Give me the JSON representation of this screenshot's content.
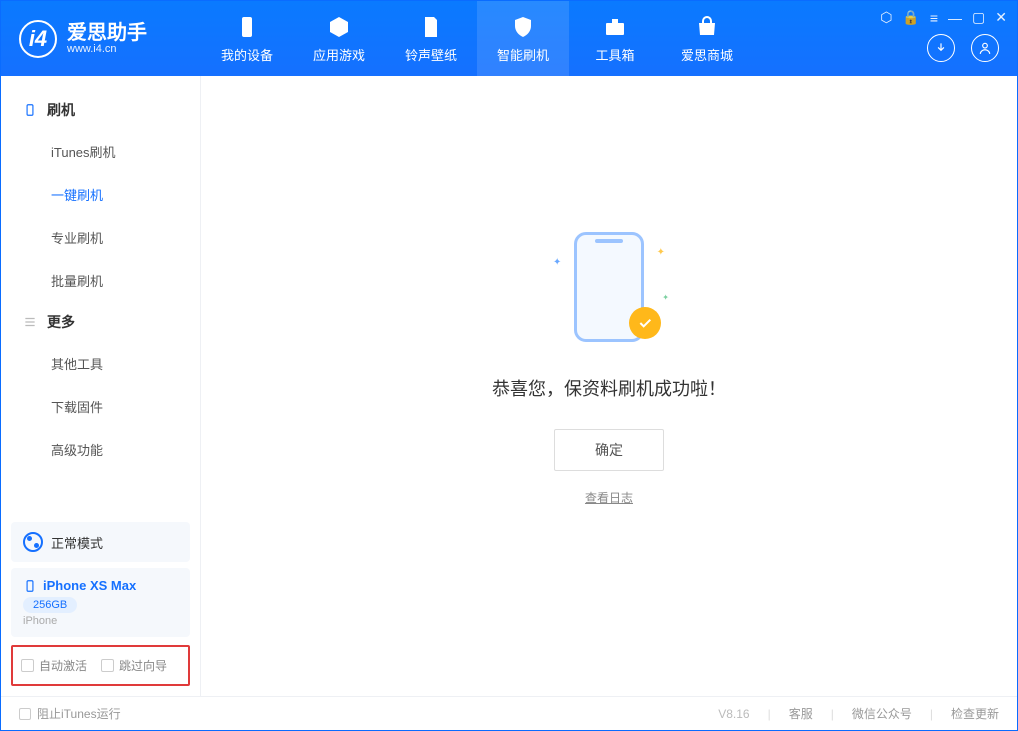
{
  "app": {
    "title": "爱思助手",
    "subtitle": "www.i4.cn"
  },
  "nav": {
    "items": [
      {
        "label": "我的设备"
      },
      {
        "label": "应用游戏"
      },
      {
        "label": "铃声壁纸"
      },
      {
        "label": "智能刷机"
      },
      {
        "label": "工具箱"
      },
      {
        "label": "爱思商城"
      }
    ]
  },
  "sidebar": {
    "group1": {
      "title": "刷机",
      "items": [
        "iTunes刷机",
        "一键刷机",
        "专业刷机",
        "批量刷机"
      ]
    },
    "group2": {
      "title": "更多",
      "items": [
        "其他工具",
        "下载固件",
        "高级功能"
      ]
    },
    "mode": "正常模式",
    "device": {
      "name": "iPhone XS Max",
      "storage": "256GB",
      "type": "iPhone"
    },
    "checks": {
      "auto_activate": "自动激活",
      "skip_guide": "跳过向导"
    }
  },
  "main": {
    "success": "恭喜您，保资料刷机成功啦！",
    "ok": "确定",
    "log": "查看日志"
  },
  "footer": {
    "block_itunes": "阻止iTunes运行",
    "version": "V8.16",
    "support": "客服",
    "wechat": "微信公众号",
    "update": "检查更新"
  }
}
